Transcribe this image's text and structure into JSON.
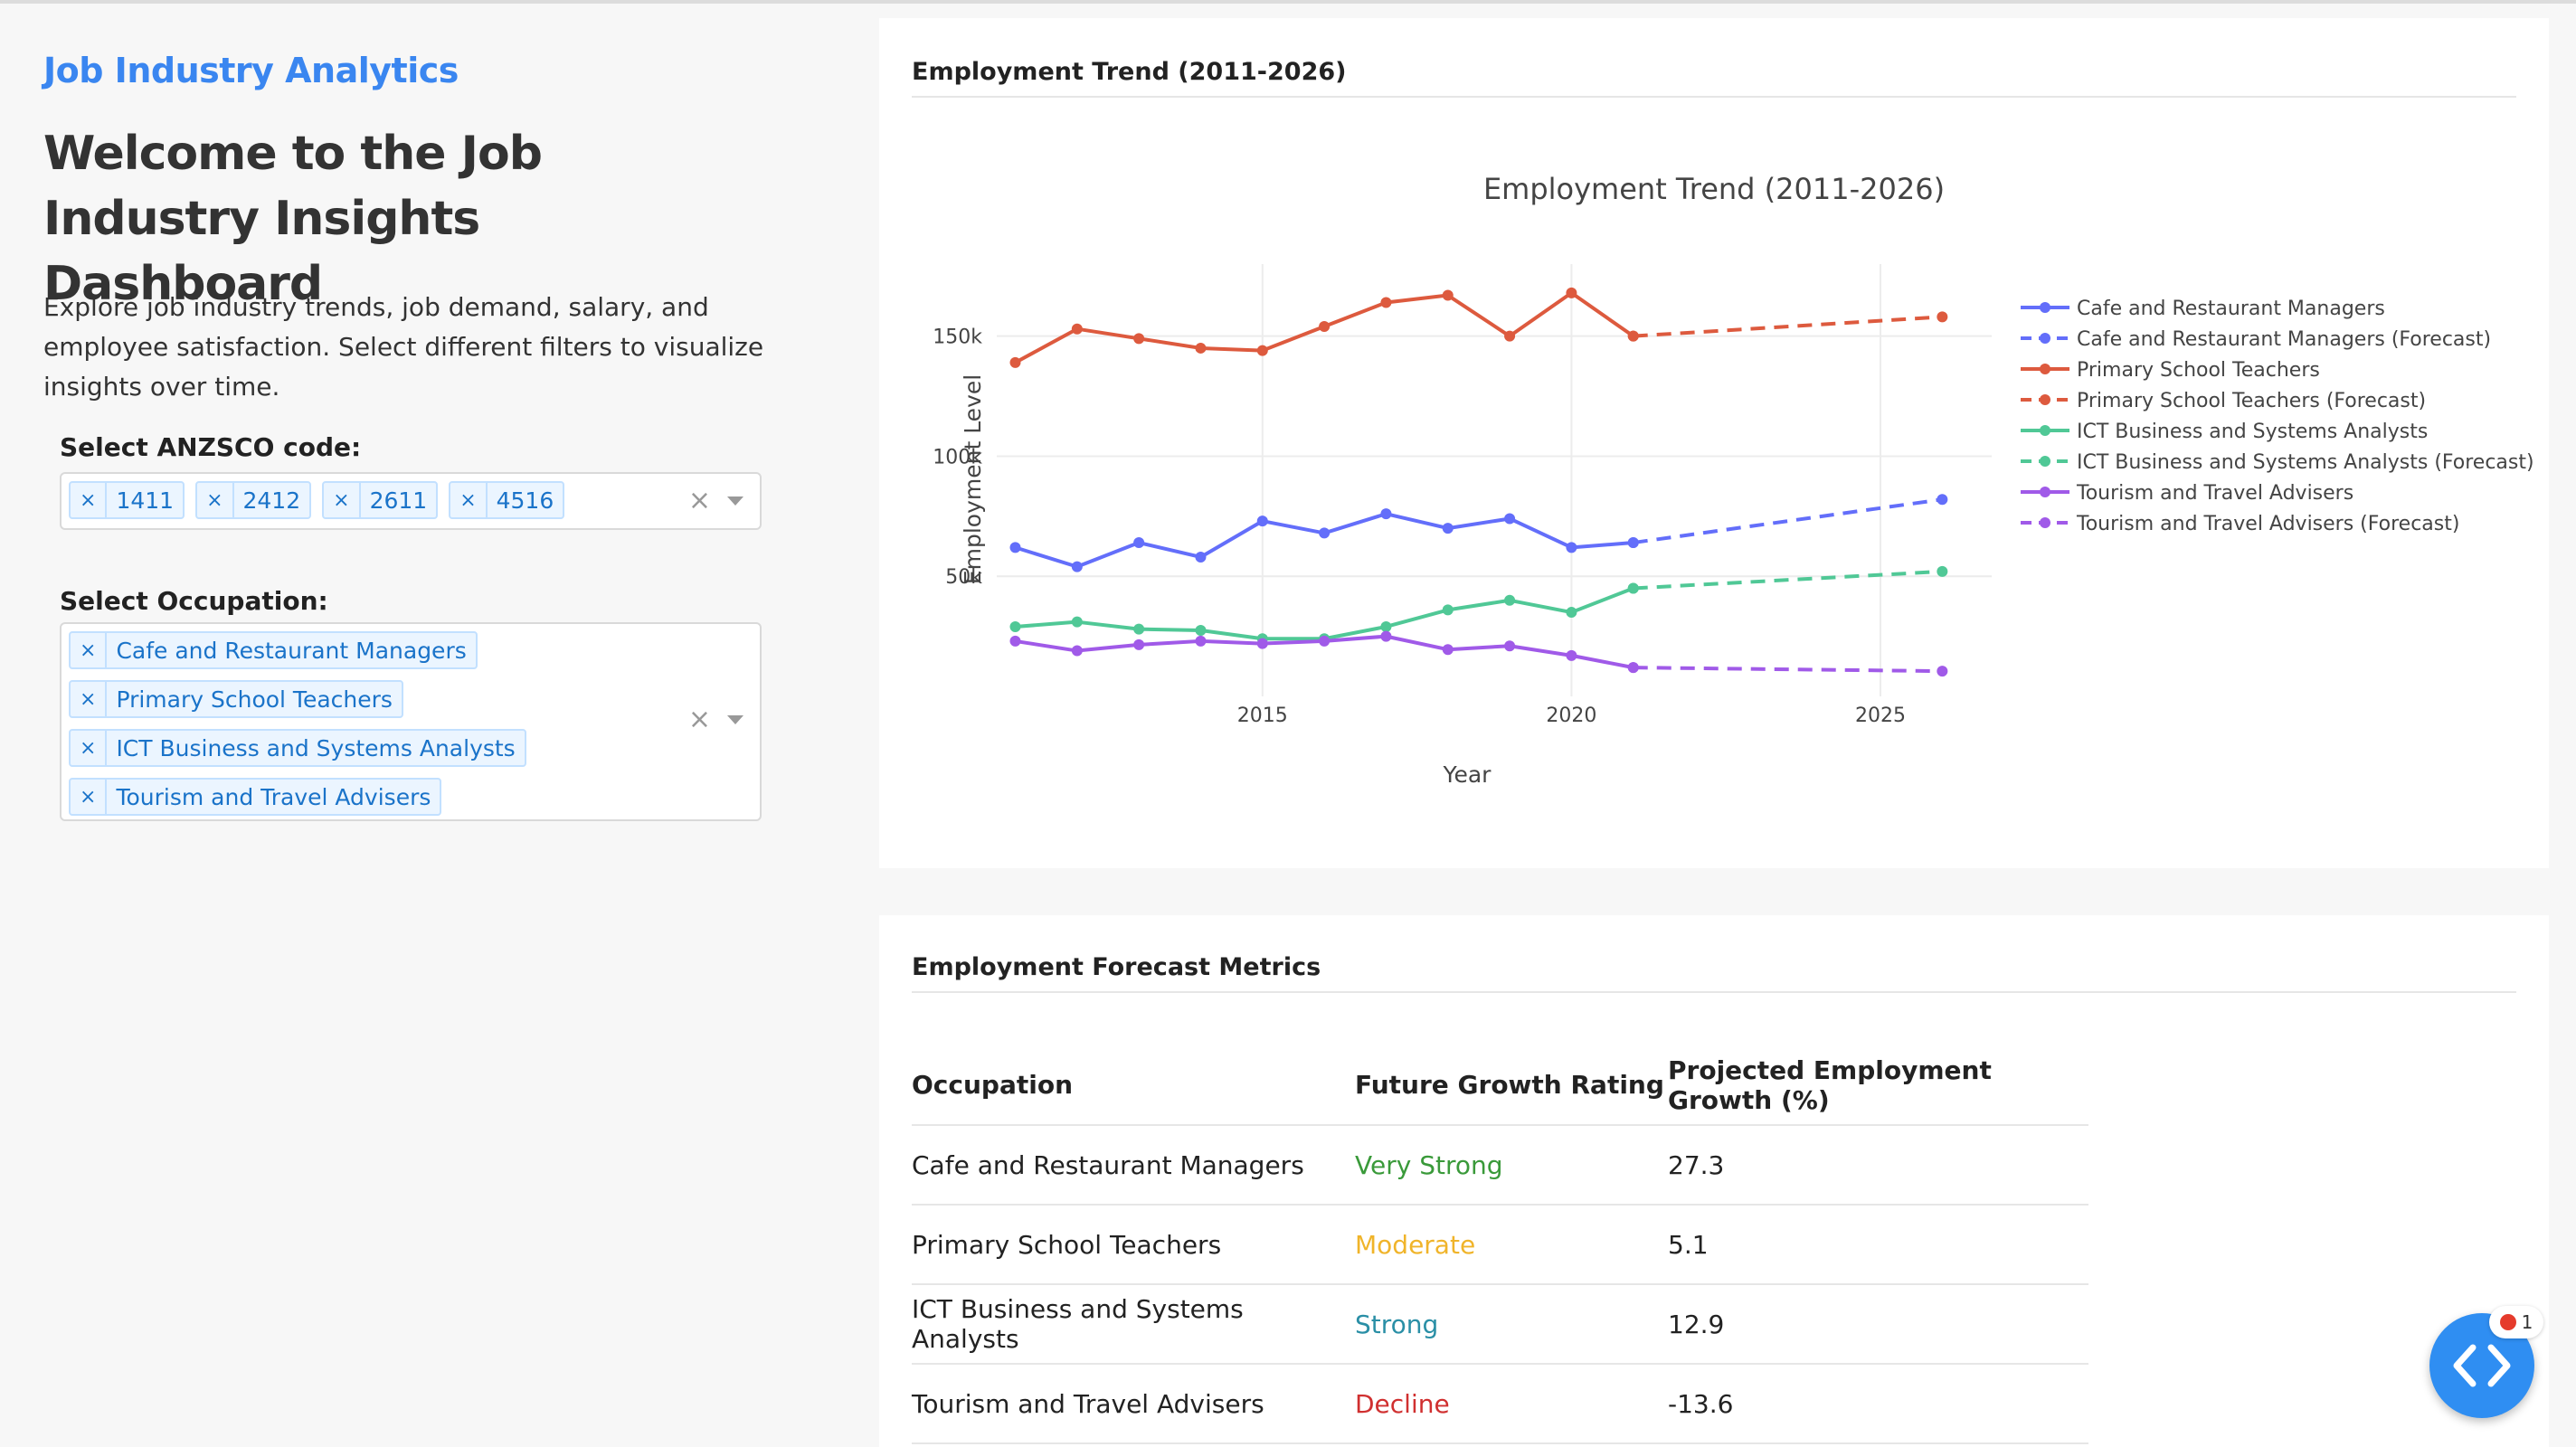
{
  "app_title": "Job Industry Analytics",
  "welcome_heading": "Welcome to the Job Industry Insights Dashboard",
  "intro_text": "Explore job industry trends, job demand, salary, and employee satisfaction. Select different filters to visualize insights over time.",
  "anzsco": {
    "label": "Select ANZSCO code:",
    "selected": [
      "1411",
      "2412",
      "2611",
      "4516"
    ]
  },
  "occupation": {
    "label": "Select Occupation:",
    "selected": [
      "Cafe and Restaurant Managers",
      "Primary School Teachers",
      "ICT Business and Systems Analysts",
      "Tourism and Travel Advisers"
    ]
  },
  "dropdown_icons": {
    "clear": "×",
    "remove_tag": "×"
  },
  "trend_card": {
    "title": "Employment Trend (2011-2026)"
  },
  "chart_data": {
    "type": "line",
    "title": "Employment Trend (2011-2026)",
    "xlabel": "Year",
    "ylabel": "Employment Level",
    "xlim": [
      2010.7,
      2026.8
    ],
    "ylim": [
      0,
      180000
    ],
    "x_ticks": [
      2015,
      2020,
      2025
    ],
    "y_ticks": [
      50000,
      100000,
      150000
    ],
    "y_tick_labels": [
      "50k",
      "100k",
      "150k"
    ],
    "grid": true,
    "legend_position": "right",
    "series": [
      {
        "name": "Cafe and Restaurant Managers",
        "color": "#636efa",
        "dashed": false,
        "x": [
          2011,
          2012,
          2013,
          2014,
          2015,
          2016,
          2017,
          2018,
          2019,
          2020,
          2021
        ],
        "y": [
          62000,
          54000,
          64000,
          58000,
          73000,
          68000,
          76000,
          70000,
          74000,
          62000,
          64000
        ]
      },
      {
        "name": "Cafe and Restaurant Managers (Forecast)",
        "color": "#636efa",
        "dashed": true,
        "x": [
          2021,
          2026
        ],
        "y": [
          64000,
          82000
        ]
      },
      {
        "name": "Primary School Teachers",
        "color": "#dd5a3e",
        "dashed": false,
        "x": [
          2011,
          2012,
          2013,
          2014,
          2015,
          2016,
          2017,
          2018,
          2019,
          2020,
          2021
        ],
        "y": [
          139000,
          153000,
          149000,
          145000,
          144000,
          154000,
          164000,
          167000,
          150000,
          168000,
          150000
        ]
      },
      {
        "name": "Primary School Teachers (Forecast)",
        "color": "#dd5a3e",
        "dashed": true,
        "x": [
          2021,
          2026
        ],
        "y": [
          150000,
          158000
        ]
      },
      {
        "name": "ICT Business and Systems Analysts",
        "color": "#50c896",
        "dashed": false,
        "x": [
          2011,
          2012,
          2013,
          2014,
          2015,
          2016,
          2017,
          2018,
          2019,
          2020,
          2021
        ],
        "y": [
          29000,
          31000,
          28000,
          27500,
          24000,
          24000,
          29000,
          36000,
          40000,
          35000,
          45000
        ]
      },
      {
        "name": "ICT Business and Systems Analysts (Forecast)",
        "color": "#50c896",
        "dashed": true,
        "x": [
          2021,
          2026
        ],
        "y": [
          45000,
          52000
        ]
      },
      {
        "name": "Tourism and Travel Advisers",
        "color": "#a05ae8",
        "dashed": false,
        "x": [
          2011,
          2012,
          2013,
          2014,
          2015,
          2016,
          2017,
          2018,
          2019,
          2020,
          2021
        ],
        "y": [
          23000,
          19000,
          21500,
          23000,
          22000,
          23000,
          25000,
          19500,
          21000,
          17000,
          12000
        ]
      },
      {
        "name": "Tourism and Travel Advisers (Forecast)",
        "color": "#a05ae8",
        "dashed": true,
        "x": [
          2021,
          2026
        ],
        "y": [
          12000,
          10500
        ]
      }
    ]
  },
  "forecast_card": {
    "title": "Employment Forecast Metrics",
    "columns": [
      "Occupation",
      "Future Growth Rating",
      "Projected Employment Growth (%)"
    ],
    "rows": [
      {
        "occupation": "Cafe and Restaurant Managers",
        "rating": "Very Strong",
        "rating_color": "#3a9a3a",
        "growth": "27.3"
      },
      {
        "occupation": "Primary School Teachers",
        "rating": "Moderate",
        "rating_color": "#f0b42a",
        "growth": "5.1"
      },
      {
        "occupation": "ICT Business and Systems Analysts",
        "rating": "Strong",
        "rating_color": "#2a8fa6",
        "growth": "12.9"
      },
      {
        "occupation": "Tourism and Travel Advisers",
        "rating": "Decline",
        "rating_color": "#d03030",
        "growth": "-13.6"
      }
    ]
  },
  "devtools_badge": {
    "count": "1"
  }
}
